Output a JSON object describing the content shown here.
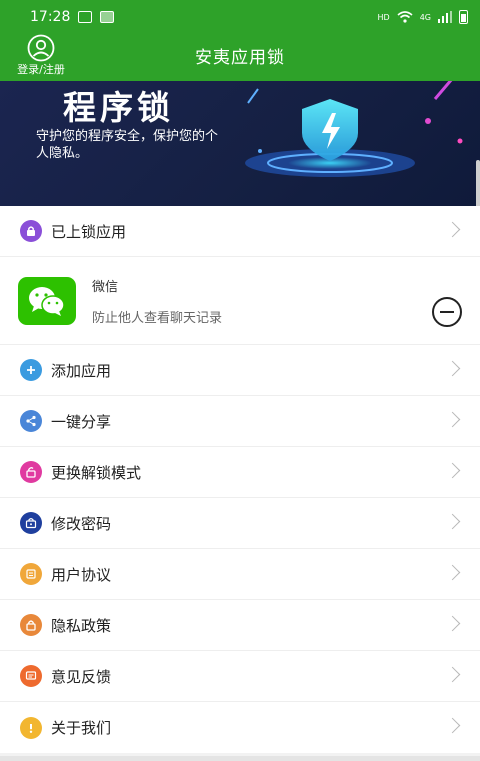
{
  "status": {
    "time": "17:28",
    "network_hd": "HD",
    "network_gen": "4G"
  },
  "header": {
    "login_label": "登录/注册",
    "title": "安夷应用锁"
  },
  "banner": {
    "title": "程序锁",
    "subtitle": "守护您的程序安全，保护您的个人隐私。"
  },
  "locked_section": {
    "label": "已上锁应用"
  },
  "locked_apps": [
    {
      "name": "微信",
      "description": "防止他人查看聊天记录",
      "icon": "wechat-icon"
    }
  ],
  "menu": [
    {
      "label": "添加应用",
      "icon": "plus-icon",
      "color": "#3a9be0"
    },
    {
      "label": "一键分享",
      "icon": "share-icon",
      "color": "#4a86d8"
    },
    {
      "label": "更换解锁模式",
      "icon": "unlock-icon",
      "color": "#e03aa0"
    },
    {
      "label": "修改密码",
      "icon": "password-icon",
      "color": "#1f3f9e"
    },
    {
      "label": "用户协议",
      "icon": "document-icon",
      "color": "#f0a73a"
    },
    {
      "label": "隐私政策",
      "icon": "privacy-lock-icon",
      "color": "#e8883a"
    },
    {
      "label": "意见反馈",
      "icon": "feedback-icon",
      "color": "#ee6a2e"
    },
    {
      "label": "关于我们",
      "icon": "info-icon",
      "color": "#f2b630"
    }
  ],
  "colors": {
    "primary": "#2ea229",
    "locked_icon": "#8a4fd8"
  }
}
